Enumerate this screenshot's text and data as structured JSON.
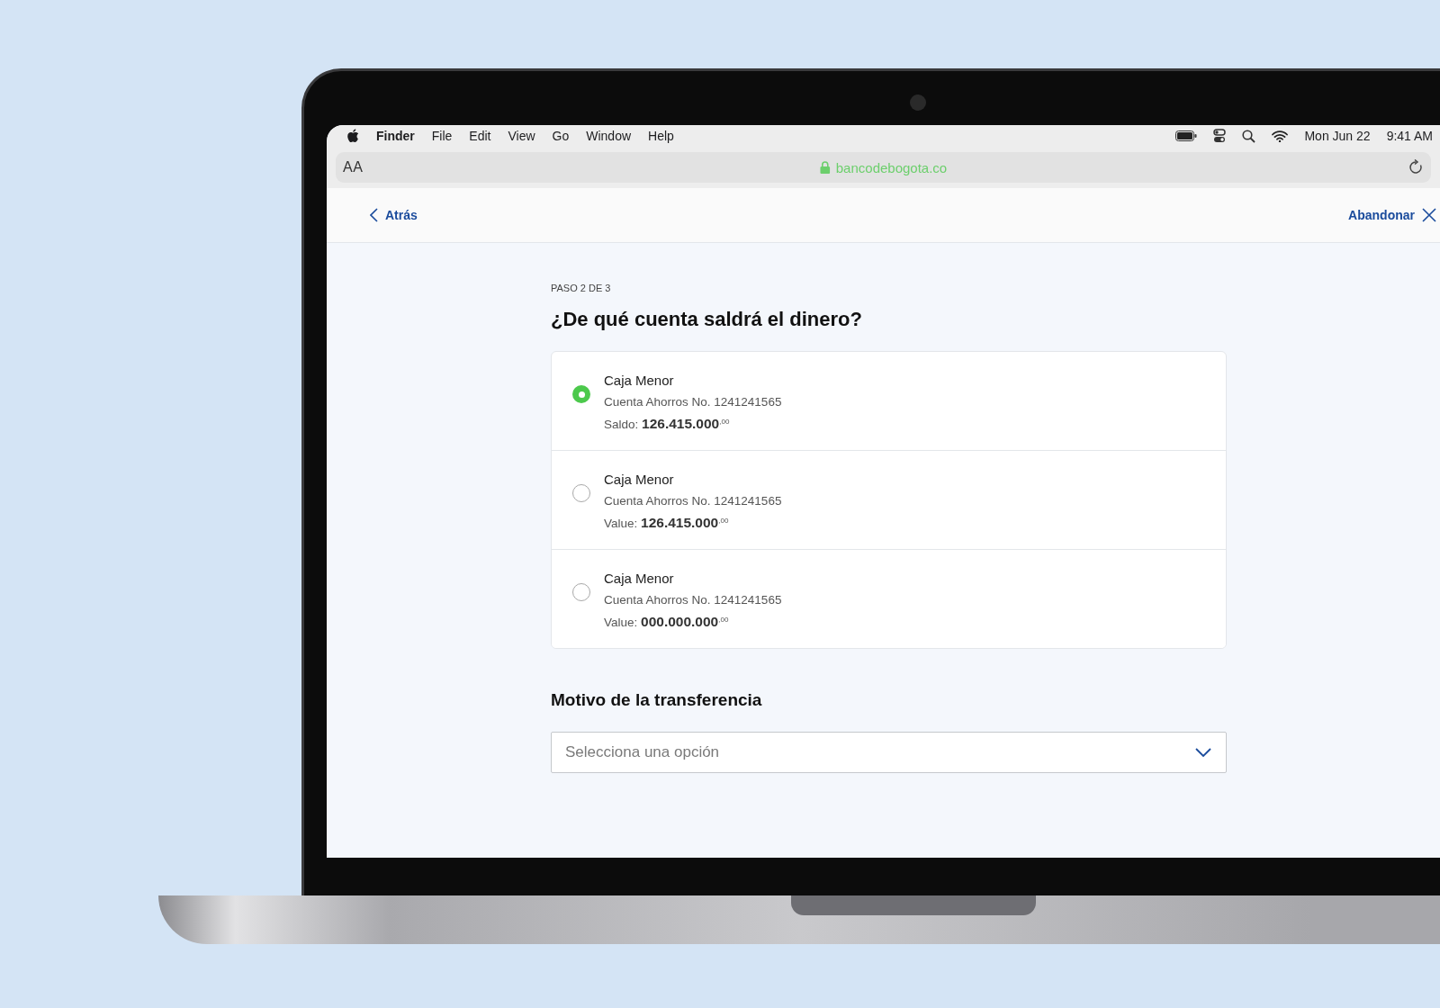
{
  "menu_bar": {
    "app": "Finder",
    "items": [
      "File",
      "Edit",
      "View",
      "Go",
      "Window",
      "Help"
    ],
    "date": "Mon Jun 22",
    "time": "9:41 AM"
  },
  "address_bar": {
    "text_size": "AA",
    "url": "bancodebogota.co"
  },
  "nav": {
    "back": "Atrás",
    "exit": "Abandonar"
  },
  "step": "PASO 2 DE 3",
  "title": "¿De qué cuenta saldrá el dinero?",
  "accounts": [
    {
      "name": "Caja Menor",
      "number": "Cuenta Ahorros No. 1241241565",
      "balance": "Saldo: **126.415.000**$^{,00}$",
      "selected": true
    },
    {
      "name": "Caja Menor",
      "number": "Cuenta Ahorros No. 1241241565",
      "balance": "Value: **126.415.000**$^{,00}$",
      "selected": false
    },
    {
      "name": "Caja Menor",
      "number": "Cuenta Ahorros No. 1241241565",
      "balance": "Value: **000.000.000**$^{,00}$",
      "selected": false
    }
  ],
  "reason": {
    "label": "Motivo de la transferencia",
    "placeholder": "Selecciona una opción"
  }
}
